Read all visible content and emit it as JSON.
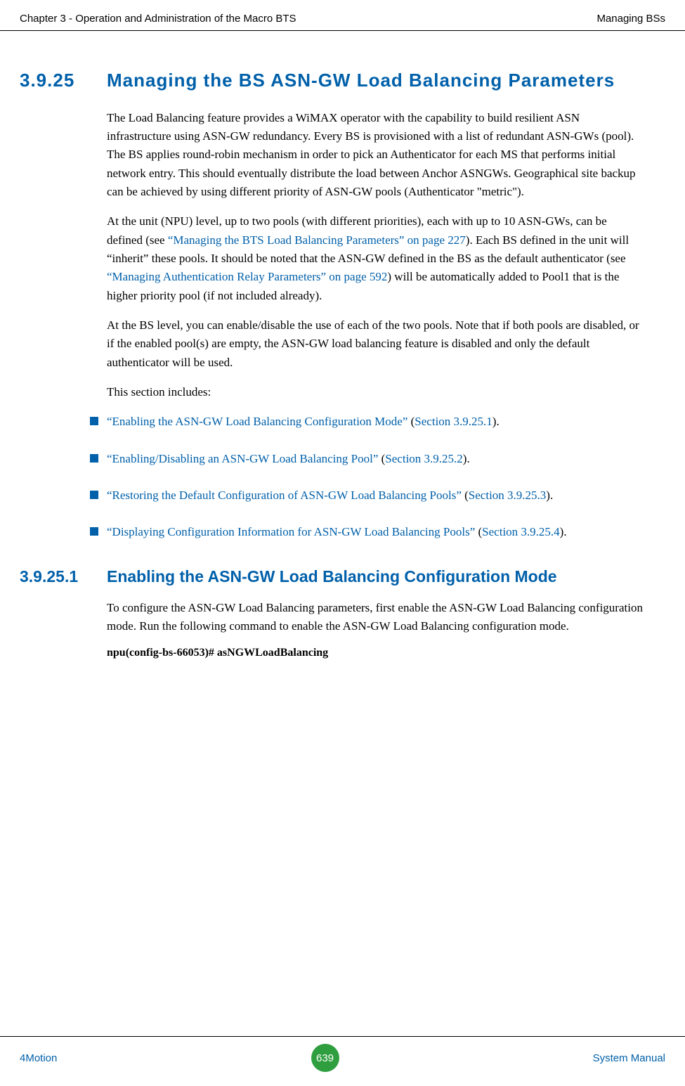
{
  "header": {
    "left": "Chapter 3 - Operation and Administration of the Macro BTS",
    "right": "Managing BSs"
  },
  "section": {
    "number": "3.9.25",
    "title": "Managing the BS ASN-GW Load Balancing Parameters"
  },
  "para1": "The Load Balancing feature provides a WiMAX operator with the capability to build resilient ASN infrastructure using ASN-GW redundancy. Every BS is provisioned with a list of redundant ASN-GWs (pool). The BS applies round-robin mechanism in order to pick an Authenticator for each MS that performs initial network entry. This should eventually distribute the load between Anchor ASNGWs. Geographical site backup can be achieved by using different priority of ASN-GW pools (Authenticator \"metric\").",
  "para2": {
    "pre": "At the unit (NPU) level, up to two pools (with different priorities), each with up to 10 ASN-GWs, can be defined (see ",
    "link1": "“Managing the BTS Load Balancing Parameters” on page 227",
    "mid": "). Each BS defined in the unit will “inherit” these pools. It should be noted that the ASN-GW defined in the BS as the default authenticator (see ",
    "link2": "“Managing Authentication Relay Parameters” on page 592",
    "post": ") will be automatically added to Pool1 that is the higher priority pool (if not included already)."
  },
  "para3": "At the BS level, you can enable/disable the use of each of the two pools. Note that if both pools are disabled, or if the enabled pool(s) are empty, the ASN-GW load balancing feature is disabled and only the default authenticator will be used.",
  "para4": "This section includes:",
  "bullets": [
    {
      "link": "“Enabling the ASN-GW Load Balancing Configuration Mode”",
      "paren_open": " (",
      "section": "Section 3.9.25.1",
      "paren_close": ")."
    },
    {
      "link": "“Enabling/Disabling an ASN-GW Load Balancing Pool”",
      "paren_open": " (",
      "section": "Section 3.9.25.2",
      "paren_close": ")."
    },
    {
      "link": "“Restoring the Default Configuration of ASN-GW Load Balancing Pools”",
      "paren_open": " (",
      "section": "Section 3.9.25.3",
      "paren_close": ")."
    },
    {
      "link": "“Displaying Configuration Information for ASN-GW Load Balancing Pools”",
      "paren_open": " (",
      "section": "Section 3.9.25.4",
      "paren_close": ")."
    }
  ],
  "subsection": {
    "number": "3.9.25.1",
    "title": "Enabling the ASN-GW Load Balancing Configuration Mode"
  },
  "sub_para": "To configure the ASN-GW Load Balancing parameters, first enable the ASN-GW Load Balancing configuration mode. Run the following command to enable the ASN-GW Load Balancing configuration mode.",
  "command": "npu(config-bs-66053)# asNGWLoadBalancing",
  "footer": {
    "left": "4Motion",
    "page": "639",
    "right": "System Manual"
  }
}
